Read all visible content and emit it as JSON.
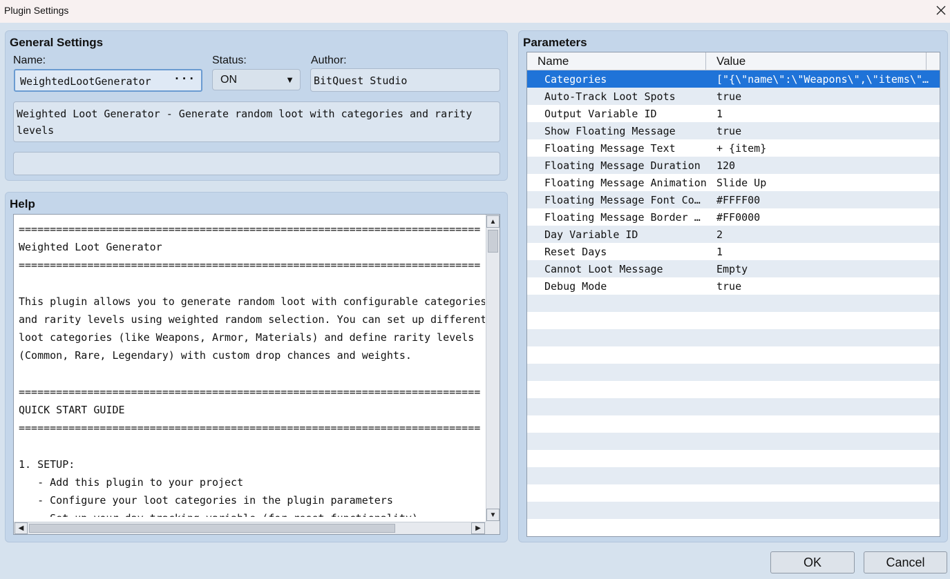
{
  "window": {
    "title": "Plugin Settings"
  },
  "general": {
    "title": "General Settings",
    "name_label": "Name:",
    "name_value": "WeightedLootGenerator",
    "name_button": "···",
    "status_label": "Status:",
    "status_value": "ON",
    "author_label": "Author:",
    "author_value": "BitQuest Studio",
    "description": "Weighted Loot Generator - Generate random loot with categories and rarity\nlevels",
    "extra": ""
  },
  "help": {
    "title": "Help",
    "text": "==========================================================================\nWeighted Loot Generator\n==========================================================================\n\nThis plugin allows you to generate random loot with configurable categories\nand rarity levels using weighted random selection. You can set up different\nloot categories (like Weapons, Armor, Materials) and define rarity levels\n(Common, Rare, Legendary) with custom drop chances and weights.\n\n==========================================================================\nQUICK START GUIDE\n==========================================================================\n\n1. SETUP:\n   - Add this plugin to your project\n   - Configure your loot categories in the plugin parameters\n   - Set up your day tracking variable (for reset functionality)"
  },
  "parameters": {
    "title": "Parameters",
    "col_name": "Name",
    "col_value": "Value",
    "rows": [
      {
        "name": "Categories",
        "value": "[\"{\\\"name\\\":\\\"Weapons\\\",\\\"items\\\"…"
      },
      {
        "name": "Auto-Track Loot Spots",
        "value": "true"
      },
      {
        "name": "Output Variable ID",
        "value": "1"
      },
      {
        "name": "Show Floating Message",
        "value": "true"
      },
      {
        "name": "Floating Message Text",
        "value": "+ {item}"
      },
      {
        "name": "Floating Message Duration",
        "value": "120"
      },
      {
        "name": "Floating Message Animation",
        "value": "Slide Up"
      },
      {
        "name": "Floating Message Font Co…",
        "value": "#FFFF00"
      },
      {
        "name": "Floating Message Border …",
        "value": "#FF0000"
      },
      {
        "name": "Day Variable ID",
        "value": "2"
      },
      {
        "name": "Reset Days",
        "value": "1"
      },
      {
        "name": "Cannot Loot Message",
        "value": "Empty"
      },
      {
        "name": "Debug Mode",
        "value": "true"
      }
    ]
  },
  "buttons": {
    "ok": "OK",
    "cancel": "Cancel"
  },
  "colors": {
    "selection": "#1f73d8",
    "panel": "#c4d6ea",
    "background": "#d6e2ee"
  }
}
